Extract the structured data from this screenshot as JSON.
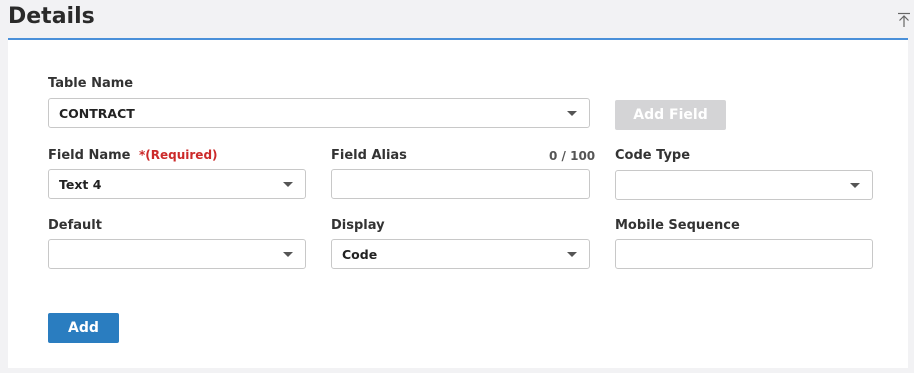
{
  "section": {
    "title": "Details"
  },
  "form": {
    "table_name": {
      "label": "Table Name",
      "value": "CONTRACT"
    },
    "add_field_button": "Add Field",
    "field_name": {
      "label": "Field Name",
      "required_marker": "*(Required)",
      "value": "Text 4"
    },
    "field_alias": {
      "label": "Field Alias",
      "counter": "0 / 100",
      "value": ""
    },
    "code_type": {
      "label": "Code Type",
      "value": ""
    },
    "default": {
      "label": "Default",
      "value": ""
    },
    "display": {
      "label": "Display",
      "value": "Code"
    },
    "mobile_sequence": {
      "label": "Mobile Sequence",
      "value": ""
    },
    "add_button": "Add"
  },
  "colors": {
    "accent": "#4a90d9",
    "primary_button": "#2a7dc0",
    "required": "#cc2a2a",
    "disabled_button": "#d4d4d6"
  }
}
